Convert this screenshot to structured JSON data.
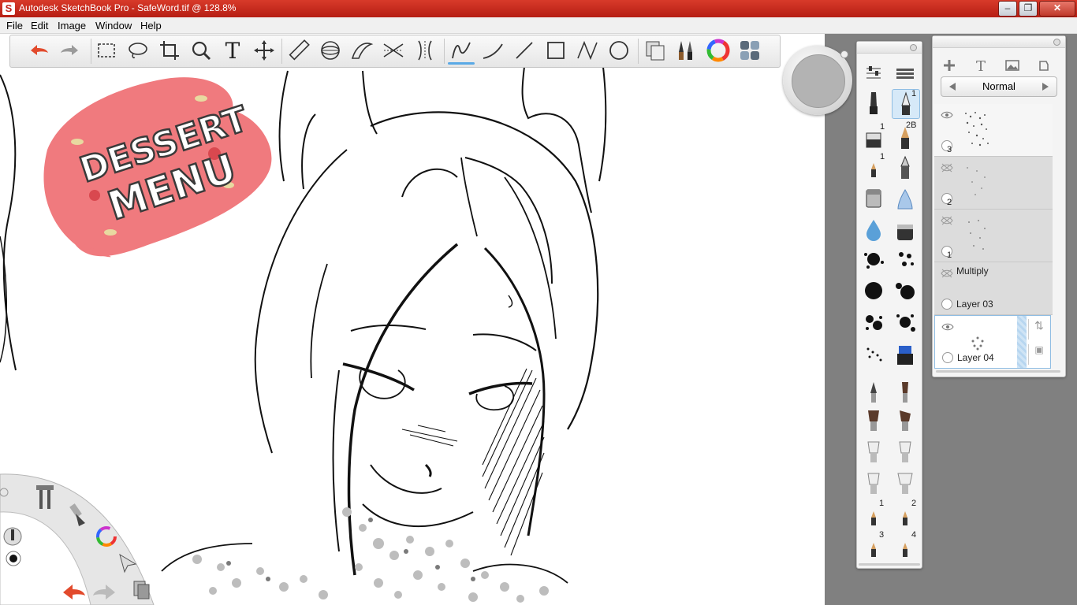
{
  "window": {
    "title": "Autodesk SketchBook Pro - SafeWord.tif @ 128.8%",
    "app_icon": "S",
    "controls": [
      "minimize",
      "maximize",
      "close"
    ],
    "accent_color": "#c0221a"
  },
  "menu": [
    "File",
    "Edit",
    "Image",
    "Window",
    "Help"
  ],
  "toolbar": {
    "tools": [
      "undo-icon",
      "redo-icon",
      "rect-select-icon",
      "lasso-select-icon",
      "crop-icon",
      "zoom-icon",
      "text-icon",
      "move-icon",
      "ruler-icon",
      "ellipse-guide-icon",
      "french-curve-icon",
      "symmetry-x-icon",
      "symmetry-y-icon",
      "freehand-line-icon",
      "curve-icon",
      "straight-line-icon",
      "rectangle-icon",
      "polyline-icon",
      "circle-icon",
      "copy-paste-icon",
      "brush-palette-icon",
      "color-wheel-icon",
      "layer-editor-icon"
    ],
    "text_tool_glyph": "T",
    "active_tool": "freehand-line-icon"
  },
  "canvas": {
    "zoom": "128.8%",
    "logo_text_line1": "DESSERT",
    "logo_text_line2": "MENU"
  },
  "brush_palette": {
    "brush_numbers": [
      "1",
      "2B",
      "1",
      "1",
      "2",
      "3",
      "4"
    ]
  },
  "layers": {
    "toolbar_text_glyph": "T",
    "blend_mode": "Normal",
    "items": [
      {
        "num": "3",
        "name": "",
        "visible": true,
        "selected": false
      },
      {
        "num": "2",
        "name": "",
        "visible": false,
        "selected": false
      },
      {
        "num": "1",
        "name": "",
        "visible": false,
        "selected": false
      },
      {
        "num": "",
        "name": "Layer 03",
        "blend": "Multiply",
        "visible": false,
        "selected": false
      },
      {
        "num": "",
        "name": "Layer 04",
        "visible": true,
        "selected": true
      }
    ]
  }
}
